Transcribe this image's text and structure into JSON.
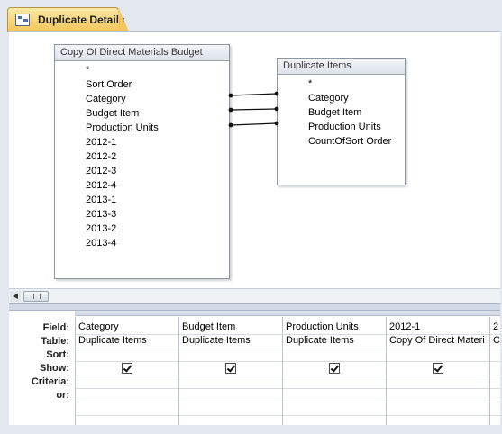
{
  "document_tab": {
    "title": "Duplicate Details"
  },
  "tables": [
    {
      "title": "Copy Of Direct Materials Budget",
      "fields": [
        "*",
        "Sort Order",
        "Category",
        "Budget Item",
        "Production Units",
        "2012-1",
        "2012-2",
        "2012-3",
        "2012-4",
        "2013-1",
        "2013-3",
        "2013-2",
        "2013-4"
      ]
    },
    {
      "title": "Duplicate Items",
      "fields": [
        "*",
        "Category",
        "Budget Item",
        "Production Units",
        "CountOfSort Order"
      ]
    }
  ],
  "grid": {
    "row_labels": [
      "Field:",
      "Table:",
      "Sort:",
      "Show:",
      "Criteria:",
      "or:"
    ],
    "columns": [
      {
        "field": "Category",
        "table": "Duplicate Items",
        "show": true
      },
      {
        "field": "Budget Item",
        "table": "Duplicate Items",
        "show": true
      },
      {
        "field": "Production Units",
        "table": "Duplicate Items",
        "show": true
      },
      {
        "field": "2012-1",
        "table": "Copy Of Direct Materi",
        "show": true
      },
      {
        "field": "2",
        "table": "C",
        "show": false
      }
    ]
  },
  "icons": {
    "tab": "query-design-icon",
    "scroll_left": "scroll-left-arrow-icon"
  }
}
